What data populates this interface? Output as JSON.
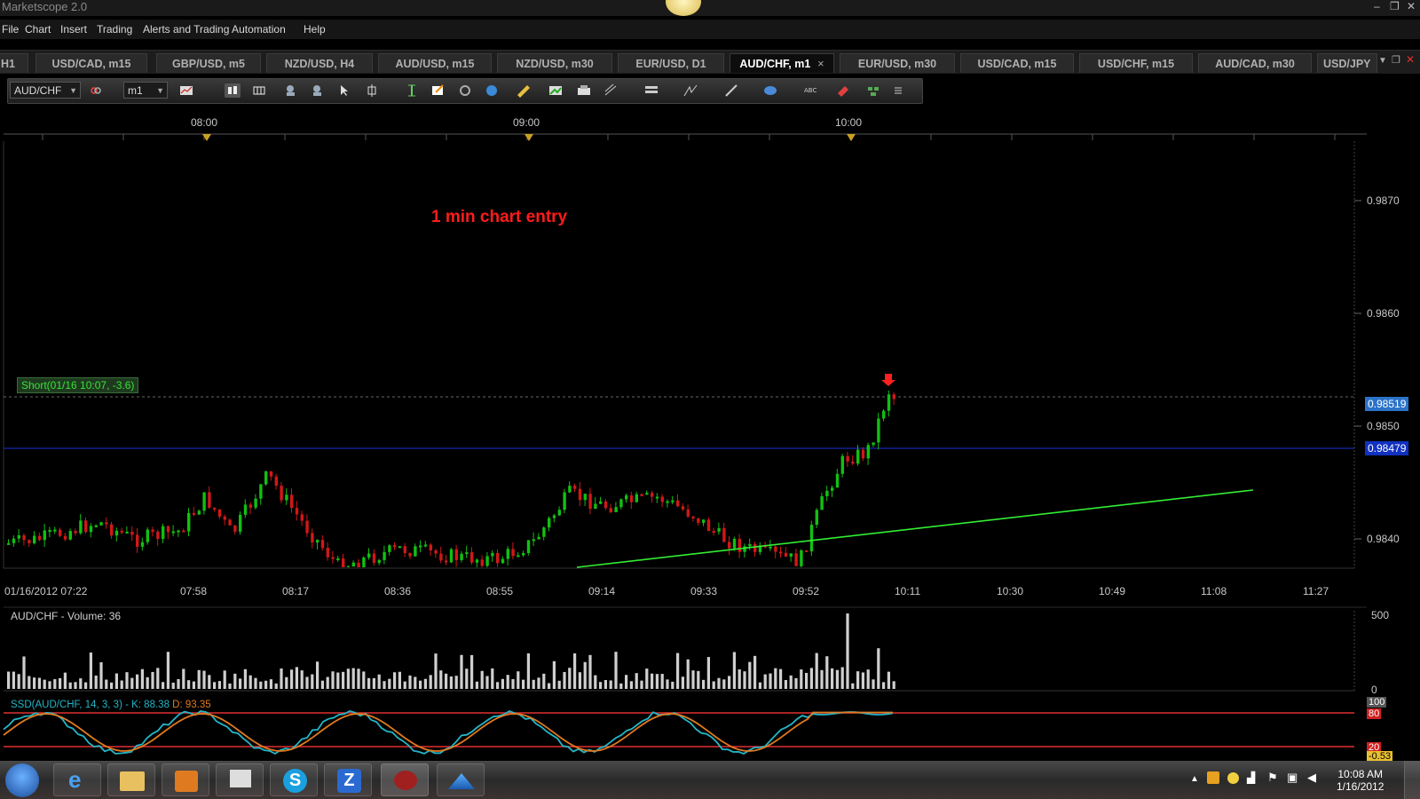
{
  "window": {
    "title": "Marketscope 2.0"
  },
  "menu": [
    "File",
    "Chart",
    "Insert",
    "Trading",
    "Alerts and Trading Automation",
    "Help"
  ],
  "tabs": [
    {
      "label": "H1"
    },
    {
      "label": "USD/CAD, m15"
    },
    {
      "label": "GBP/USD, m5"
    },
    {
      "label": "NZD/USD, H4"
    },
    {
      "label": "AUD/USD, m15"
    },
    {
      "label": "NZD/USD, m30"
    },
    {
      "label": "EUR/USD, D1"
    },
    {
      "label": "AUD/CHF, m1",
      "active": true,
      "close": "×"
    },
    {
      "label": "EUR/USD, m30"
    },
    {
      "label": "USD/CAD, m15"
    },
    {
      "label": "USD/CHF, m15"
    },
    {
      "label": "AUD/CAD, m30"
    },
    {
      "label": "USD/JPY"
    }
  ],
  "toolbar": {
    "instrument": "AUD/CHF",
    "timeframe": "m1"
  },
  "chart": {
    "header_times": [
      "08:00",
      "09:00",
      "10:00"
    ],
    "x_labels": [
      "01/16/2012 07:22",
      "07:58",
      "08:17",
      "08:36",
      "08:55",
      "09:14",
      "09:33",
      "09:52",
      "10:11",
      "10:30",
      "10:49",
      "11:08",
      "11:27"
    ],
    "y_labels": [
      "0.9870",
      "0.9860",
      "0.9850",
      "0.9840"
    ],
    "ask_price": "0.98519",
    "hline_price": "0.98479",
    "annotation": "1 min chart  entry",
    "position_label": "Short(01/16 10:07, -3.6)",
    "colors": {
      "up": "#11c011",
      "down": "#d01818",
      "hline": "#1a2fd8",
      "trend": "#33ee33",
      "ask_tag": "#2a73c8",
      "hline_tag": "#1030c0"
    }
  },
  "volume": {
    "label": "AUD/CHF - Volume: 36",
    "y_labels": [
      "500",
      "0"
    ]
  },
  "oscillator": {
    "label_name": "SSD(AUD/CHF, 14, 3, 3) -",
    "label_k": "K: 88.38",
    "label_d": "D: 93.35",
    "y_labels": [
      "100",
      "80",
      "20",
      "-0.53"
    ]
  },
  "taskbar": {
    "apps": [
      "windows-start",
      "internet-explorer",
      "file-explorer",
      "media-player",
      "presentation",
      "skype",
      "z-app",
      "marketscope",
      "chart-app"
    ],
    "time": "10:08 AM",
    "date": "1/16/2012"
  }
}
